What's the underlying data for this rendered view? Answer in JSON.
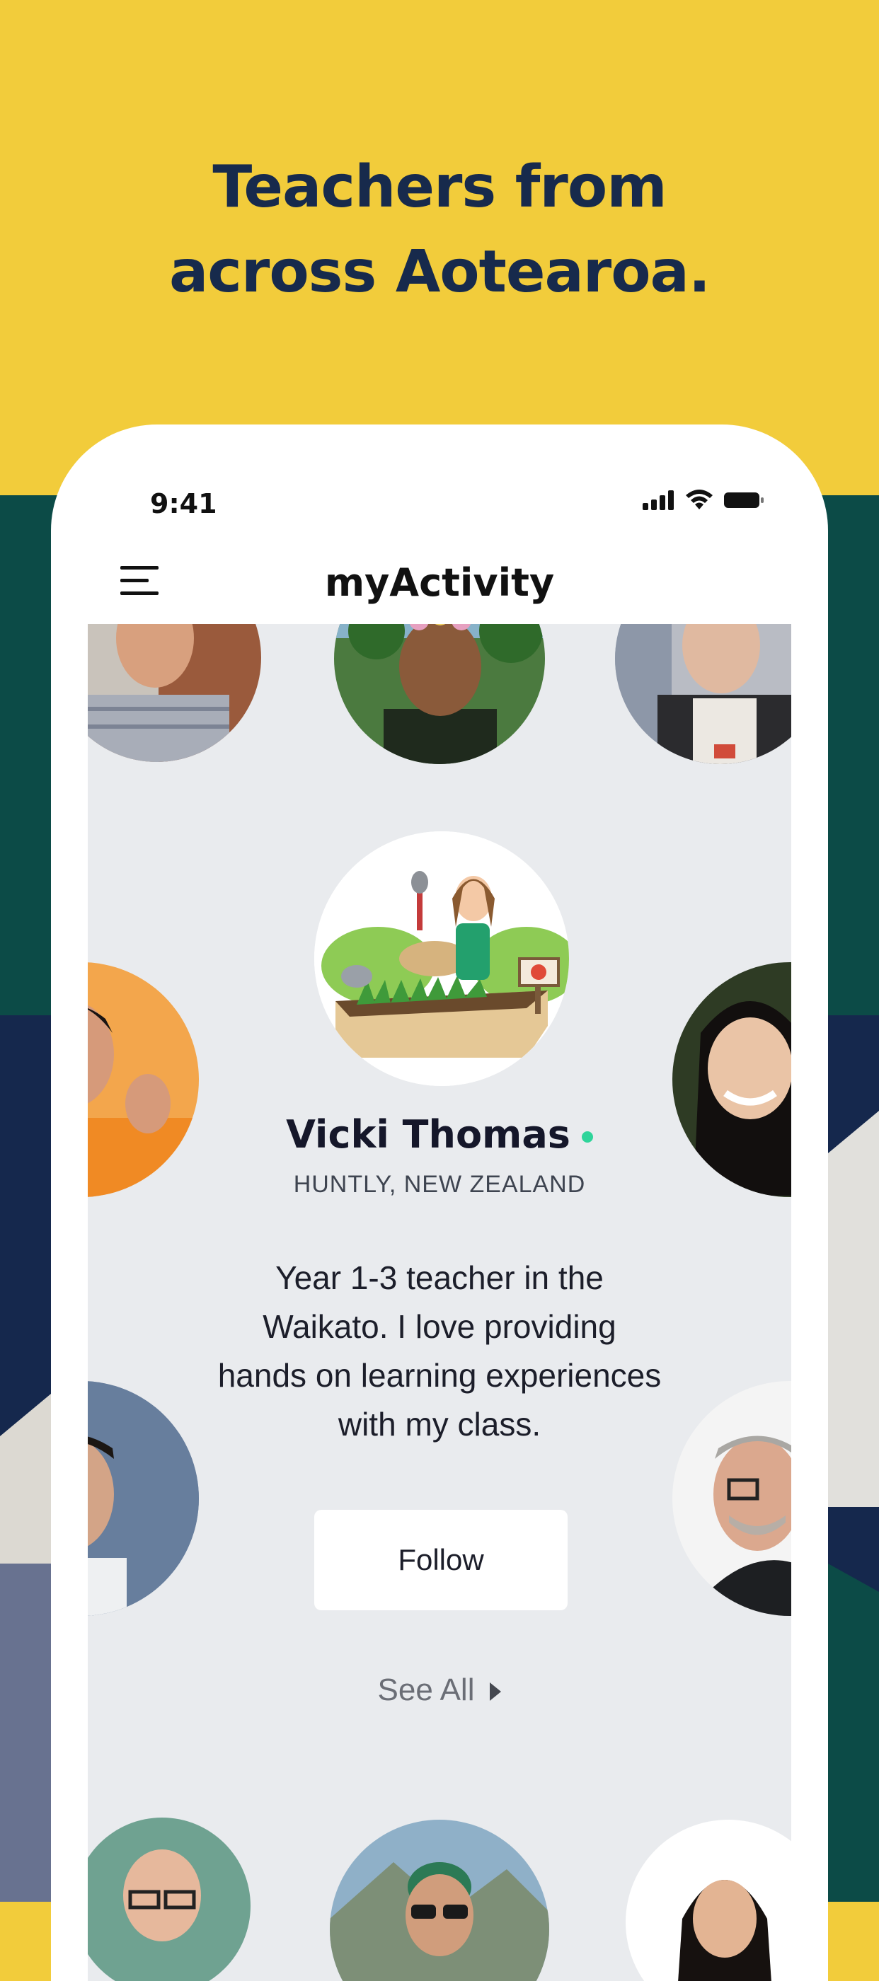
{
  "headline": {
    "line1": "Teachers from",
    "line2": "across Aotearoa."
  },
  "status_bar": {
    "time": "9:41"
  },
  "nav": {
    "title": "myActivity"
  },
  "profile": {
    "name": "Vicki Thomas",
    "online": true,
    "location": "HUNTLY, NEW ZEALAND",
    "bio": "Year 1-3 teacher in the Waikato. I love providing hands on learning experiences with my class.",
    "follow_label": "Follow",
    "see_all_label": "See All"
  },
  "colors": {
    "brand_yellow": "#f2cc3b",
    "teal": "#0c4b47",
    "navy": "#15284d",
    "online_green": "#2fd49a"
  }
}
